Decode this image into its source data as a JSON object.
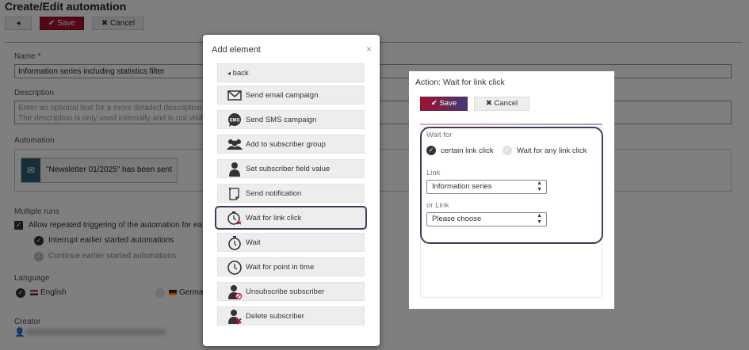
{
  "page": {
    "title": "Create/Edit automation",
    "toolbar": {
      "back_icon": "caret-left",
      "save_label": "Save",
      "cancel_label": "Cancel"
    },
    "name_label": "Name",
    "name_required": "*",
    "name_value": "Information series including statistics filter",
    "description_label": "Description",
    "description_placeholder_line1": "Enter an optional text for a more detailed description",
    "description_placeholder_line2": "The description is only used internally and is not visib",
    "automation_label": "Automation",
    "automation_item": "\"Newsletter 01/2025\" has been sent",
    "multiple_runs_label": "Multiple runs",
    "allow_repeat": "Allow repeated triggering of the automation for ea",
    "interrupt": "Interrupt earlier started automations",
    "continue": "Continue earlier started automations",
    "language_label": "Language",
    "lang_english": "English",
    "lang_german": "Germa",
    "creator_label": "Creator"
  },
  "add_modal": {
    "title": "Add element",
    "close": "×",
    "items": [
      {
        "label": "back",
        "icon": "caret-left-icon"
      },
      {
        "label": "Send email campaign",
        "icon": "envelope-icon"
      },
      {
        "label": "Send SMS campaign",
        "icon": "sms-bubble-icon",
        "icon_text": "SMS"
      },
      {
        "label": "Add to subscriber group",
        "icon": "group-icon"
      },
      {
        "label": "Set subscriber field value",
        "icon": "person-icon"
      },
      {
        "label": "Send notification",
        "icon": "notepad-icon"
      },
      {
        "label": "Wait for link click",
        "icon": "clock-cursor-icon"
      },
      {
        "label": "Wait",
        "icon": "stopwatch-icon"
      },
      {
        "label": "Wait for point in time",
        "icon": "clock-icon"
      },
      {
        "label": "Unsubscribe subscriber",
        "icon": "person-block-icon"
      },
      {
        "label": "Delete subscriber",
        "icon": "person-delete-icon"
      }
    ],
    "active_index": 6
  },
  "action_panel": {
    "title": "Action: Wait for link click",
    "save_label": "Save",
    "cancel_label": "Cancel",
    "wait_for_label": "Wait for",
    "option_certain": "certain link click",
    "option_any": "Wait for any link click",
    "link_label": "Link",
    "link_value": "Information series",
    "or_link_label": "or Link",
    "or_link_value": "Please choose"
  },
  "colors": {
    "accent": "#a5102c",
    "accent2": "#3c3a78",
    "highlight": "#3b3f57"
  }
}
